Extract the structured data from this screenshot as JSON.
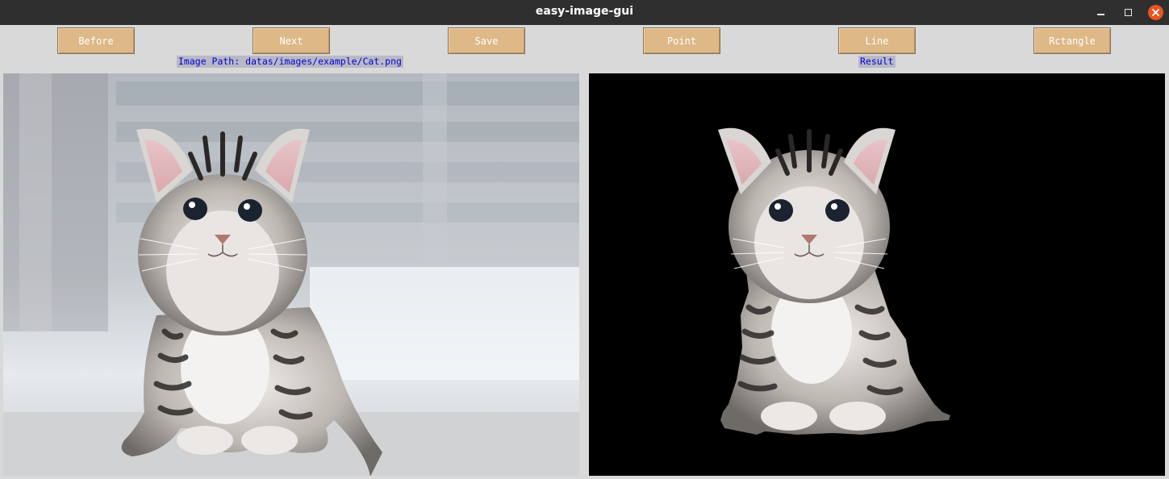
{
  "window": {
    "title": "easy-image-gui"
  },
  "window_controls": {
    "minimize_icon": "minimize-icon",
    "maximize_icon": "maximize-icon",
    "close_icon": "close-icon"
  },
  "toolbar": {
    "buttons": [
      {
        "label": "Before"
      },
      {
        "label": "Next"
      },
      {
        "label": "Save"
      },
      {
        "label": "Point"
      },
      {
        "label": "Line"
      },
      {
        "label": "Rctangle"
      }
    ],
    "button_color": "#deb887"
  },
  "labels": {
    "image_path": "Image Path: datas/images/example/Cat.png",
    "result": "Result",
    "label_text_color": "#0000d0"
  },
  "panes": {
    "source_image": "kitten photo",
    "result_image": "kitten segmented on black background"
  }
}
